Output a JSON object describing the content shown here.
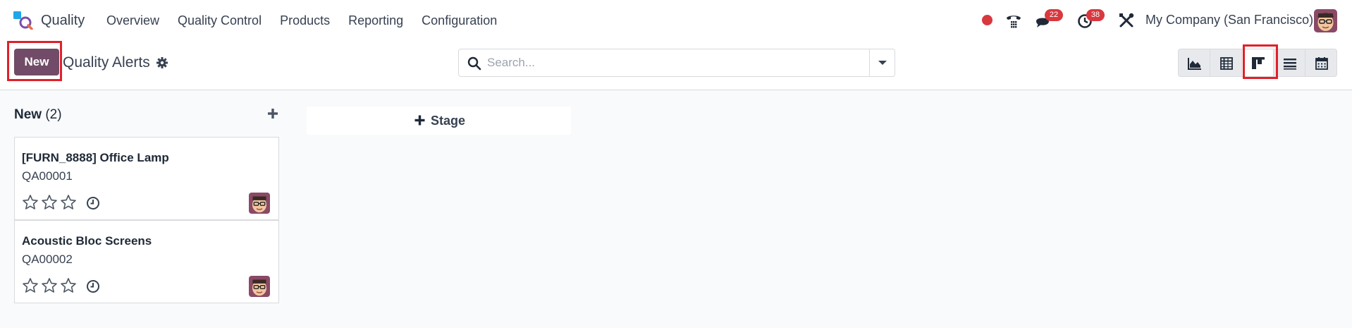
{
  "navbar": {
    "app_name": "Quality",
    "menu": [
      "Overview",
      "Quality Control",
      "Products",
      "Reporting",
      "Configuration"
    ],
    "messages_count": "22",
    "activities_count": "38",
    "company": "My Company (San Francisco)"
  },
  "control_panel": {
    "new_label": "New",
    "title": "Quality Alerts",
    "search_placeholder": "Search...",
    "views": [
      "graph-view-icon",
      "pivot-view-icon",
      "kanban-view-icon",
      "list-view-icon",
      "calendar-view-icon"
    ],
    "active_view": "kanban-view-icon"
  },
  "kanban": {
    "column": {
      "title": "New",
      "count": "(2)"
    },
    "cards": [
      {
        "name": "[FURN_8888] Office Lamp",
        "ref": "QA00001",
        "rating": 0
      },
      {
        "name": "Acoustic Bloc Screens",
        "ref": "QA00002",
        "rating": 0
      }
    ],
    "add_stage_label": "Stage"
  },
  "colors": {
    "primary": "#714b67",
    "badge": "#d9383f",
    "highlight": "#e0202a"
  }
}
